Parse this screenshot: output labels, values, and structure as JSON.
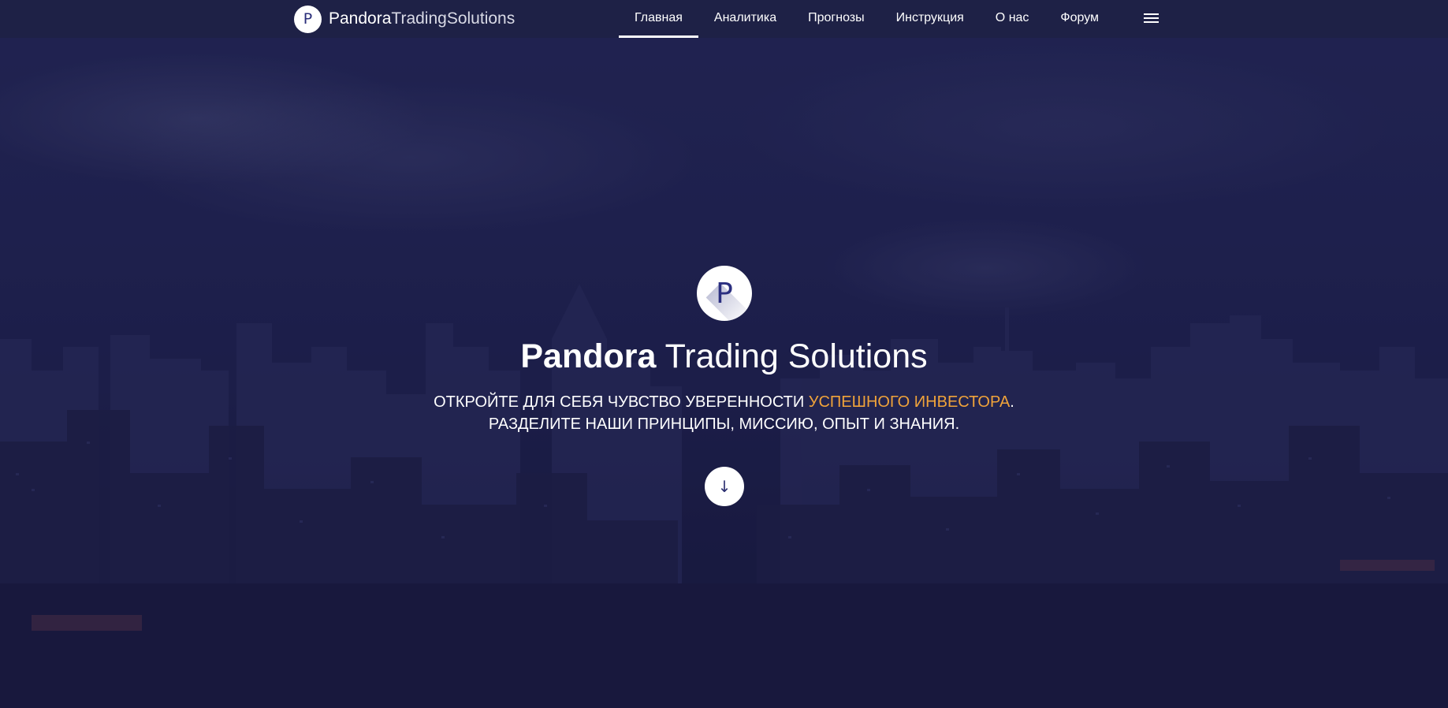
{
  "brand": {
    "logo_letter": "P",
    "name_part1": "Pandora",
    "name_part2": "TradingSolutions"
  },
  "nav": {
    "items": [
      {
        "label": "Главная",
        "active": true
      },
      {
        "label": "Аналитика",
        "active": false
      },
      {
        "label": "Прогнозы",
        "active": false
      },
      {
        "label": "Инструкция",
        "active": false
      },
      {
        "label": "О нас",
        "active": false
      },
      {
        "label": "Форум",
        "active": false
      }
    ],
    "menu_icon": "hamburger-menu-icon"
  },
  "hero": {
    "logo_letter": "P",
    "title_part1": "Pandora",
    "title_part2": " Trading Solutions",
    "subtitle_line1_prefix": "ОТКРОЙТЕ ДЛЯ СЕБЯ ЧУВСТВО УВЕРЕННОСТИ ",
    "subtitle_line1_accent": "УСПЕШНОГО ИНВЕСТОРА",
    "subtitle_line1_suffix": ".",
    "subtitle_line2": "РАЗДЕЛИТЕ НАШИ ПРИНЦИПЫ, МИССИЮ, ОПЫТ И ЗНАНИЯ.",
    "scroll_icon": "arrow-down-icon",
    "scroll_glyph": "↓"
  },
  "colors": {
    "accent": "#f0a33a",
    "overlay": "#1c1e4a",
    "text": "#ffffff",
    "logo_text": "#2b2f80"
  }
}
